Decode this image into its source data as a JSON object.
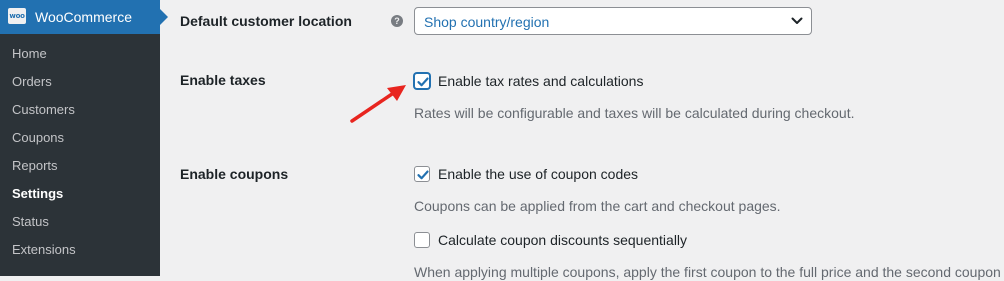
{
  "sidebar": {
    "title": "WooCommerce",
    "logo_text": "woo",
    "items": [
      {
        "label": "Home"
      },
      {
        "label": "Orders"
      },
      {
        "label": "Customers"
      },
      {
        "label": "Coupons"
      },
      {
        "label": "Reports"
      },
      {
        "label": "Settings",
        "active": true
      },
      {
        "label": "Status"
      },
      {
        "label": "Extensions"
      }
    ]
  },
  "settings": {
    "default_customer_location": {
      "label": "Default customer location",
      "help_icon": "question-circle-icon",
      "value": "Shop country/region"
    },
    "enable_taxes": {
      "label": "Enable taxes",
      "checkbox_label": "Enable tax rates and calculations",
      "checked": true,
      "description": "Rates will be configurable and taxes will be calculated during checkout."
    },
    "enable_coupons": {
      "label": "Enable coupons",
      "checkbox_label": "Enable the use of coupon codes",
      "checked": true,
      "description": "Coupons can be applied from the cart and checkout pages.",
      "sequential_label": "Calculate coupon discounts sequentially",
      "sequential_checked": false,
      "sequential_description": "When applying multiple coupons, apply the first coupon to the full price and the second coupon"
    }
  },
  "colors": {
    "accent": "#2271b1",
    "sidebar_bg": "#2c3338",
    "annotation_arrow": "#e8251f"
  }
}
